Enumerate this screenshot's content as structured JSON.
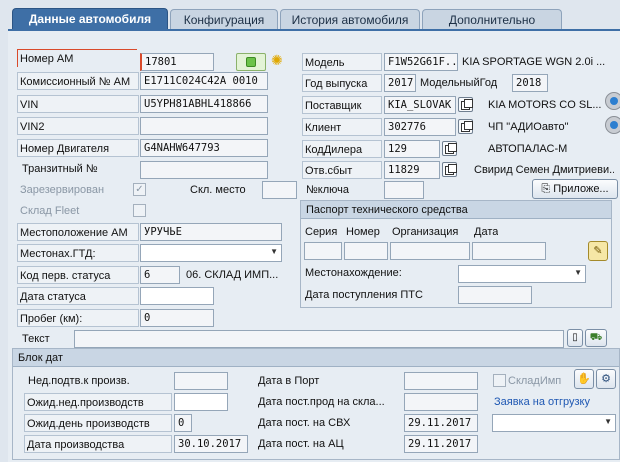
{
  "tabs": [
    "Данные автомобиля",
    "Конфигурация",
    "История автомобиля",
    "Дополнительно"
  ],
  "left": {
    "nomer_am": {
      "label": "Номер АМ",
      "value": "17801"
    },
    "komission": {
      "label": "Комиссионный № АМ",
      "value": "E1711C024C42A 0010"
    },
    "vin": {
      "label": "VIN",
      "value": "U5YPH81ABHL418866"
    },
    "vin2": {
      "label": "VIN2",
      "value": ""
    },
    "engine": {
      "label": "Номер Двигателя",
      "value": "G4NAHW647793"
    },
    "transit": {
      "label": "Транзитный №",
      "value": ""
    },
    "reserved": {
      "label": "Зарезервирован",
      "check": "✓"
    },
    "skl_mesto": {
      "label": "Скл. место",
      "value": ""
    },
    "sklad_fleet": {
      "label": "Склад Fleet"
    },
    "location": {
      "label": "Местоположение АМ",
      "value": "УРУЧЬЕ"
    },
    "gtd": {
      "label": "Местонах.ГТД:",
      "value": ""
    },
    "status_code": {
      "label": "Код перв. статуса",
      "value": "6",
      "desc": "06. СКЛАД ИМП..."
    },
    "status_date": {
      "label": "Дата статуса",
      "value": ""
    },
    "probeg": {
      "label": "Пробег (км):",
      "value": "0"
    }
  },
  "right": {
    "model": {
      "label": "Модель",
      "code": "F1W52G61F...",
      "text": "KIA SPORTAGE WGN 2.0i ..."
    },
    "year": {
      "label": "Год выпуска",
      "value": "2017",
      "model_year_label": "МодельныйГод",
      "model_year": "2018"
    },
    "supplier": {
      "label": "Поставщик",
      "value": "KIA_SLOVAK",
      "text": "KIA MOTORS CO SL..."
    },
    "client": {
      "label": "Клиент",
      "value": "302776",
      "text": "ЧП \"АДИОавто\""
    },
    "dealer": {
      "label": "КодДилера",
      "value": "129",
      "text": "АВТОПАЛАС-М"
    },
    "otv_sbyt": {
      "label": "Отв.сбыт",
      "value": "11829",
      "text": "Свирид Семен Дмитриеви..."
    },
    "key_no": {
      "label": "№ключа",
      "value": "",
      "button": "Приложе..."
    }
  },
  "pts": {
    "title": "Паспорт технического средства",
    "headers": [
      "Серия",
      "Номер",
      "Организация",
      "Дата"
    ],
    "location_label": "Местонахождение:",
    "date_label": "Дата поступления ПТС"
  },
  "text_row": {
    "label": "Текст",
    "value": ""
  },
  "dates_block": {
    "title": "Блок дат",
    "left": [
      {
        "label": "Нед.подтв.к произв.",
        "value": ""
      },
      {
        "label": "Ожид.нед.производств",
        "value": ""
      },
      {
        "label": "Ожид.день производств",
        "value": "0"
      },
      {
        "label": "Дата производства",
        "value": "30.10.2017"
      }
    ],
    "mid": [
      {
        "label": "Дата в Порт",
        "value": ""
      },
      {
        "label": "Дата пост.прод на скла...",
        "value": ""
      },
      {
        "label": "Дата пост. на СВХ",
        "value": "29.11.2017"
      },
      {
        "label": "Дата пост. на АЦ",
        "value": "29.11.2017"
      }
    ],
    "sklad_imp": "СкладИмп",
    "zayavka": "Заявка на отгрузку"
  }
}
